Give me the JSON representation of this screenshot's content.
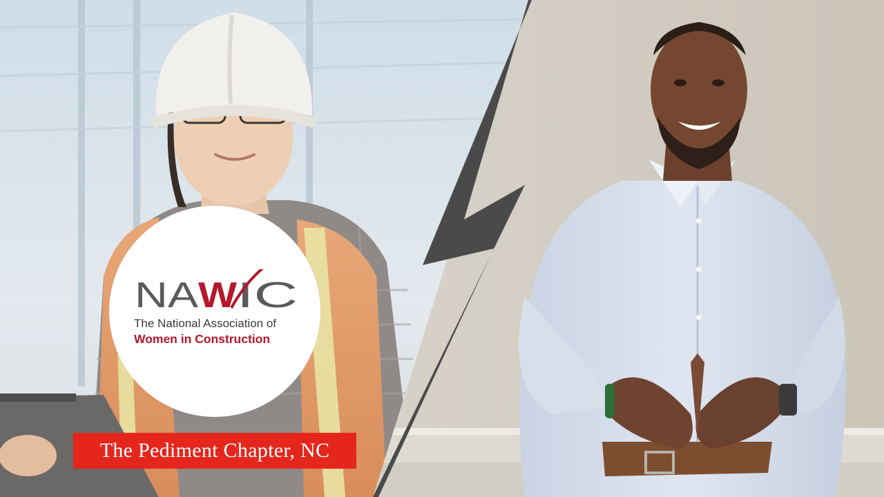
{
  "logo": {
    "wordmark": "NAWIC",
    "tagline_line1": "The National Association of",
    "tagline_line2": "Women in Construction"
  },
  "banner": {
    "label": "The Pediment Chapter, NC"
  },
  "colors": {
    "banner_red": "#e5261d",
    "logo_red": "#b5182b",
    "bolt": "#4a4a4a"
  }
}
